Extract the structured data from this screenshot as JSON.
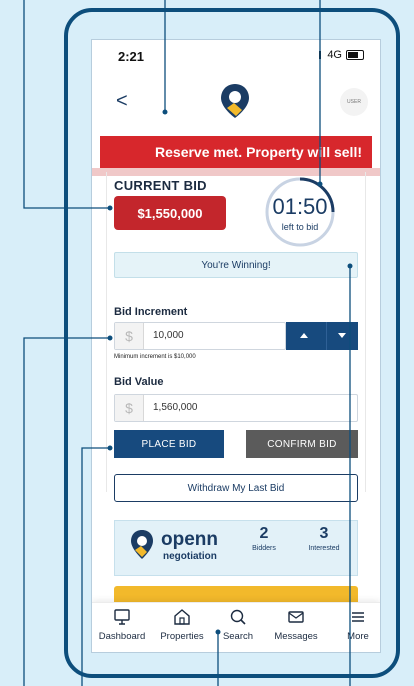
{
  "status_bar": {
    "time": "2:21",
    "network": "4G"
  },
  "header": {
    "back_symbol": "<",
    "avatar_text": "USER"
  },
  "banner": {
    "text": "Reserve met. Property will sell!"
  },
  "bid": {
    "current_label": "CURRENT BID",
    "current_amount": "$1,550,000",
    "timer": "01:50",
    "timer_sub": "left to bid",
    "winning_text": "You're Winning!"
  },
  "increment": {
    "label": "Bid Increment",
    "currency": "$",
    "value": "10,000",
    "hint": "Minimum increment is $10,000"
  },
  "bid_value": {
    "label": "Bid Value",
    "currency": "$",
    "value": "1,560,000"
  },
  "buttons": {
    "place": "PLACE BID",
    "confirm": "CONFIRM BID",
    "withdraw": "Withdraw My Last Bid"
  },
  "openn": {
    "brand": "openn",
    "brand_sub": "negotiation",
    "bidders_count": "2",
    "bidders_label": "Bidders",
    "interested_count": "3",
    "interested_label": "Interested"
  },
  "tabs": [
    {
      "label": "Dashboard",
      "icon": "monitor-icon"
    },
    {
      "label": "Properties",
      "icon": "home-icon"
    },
    {
      "label": "Search",
      "icon": "search-icon"
    },
    {
      "label": "Messages",
      "icon": "envelope-icon"
    },
    {
      "label": "More",
      "icon": "menu-icon"
    }
  ],
  "colors": {
    "navy": "#1b3c64",
    "red": "#d7272c",
    "gold": "#f2b92b",
    "light_blue": "#e5f3f8"
  }
}
